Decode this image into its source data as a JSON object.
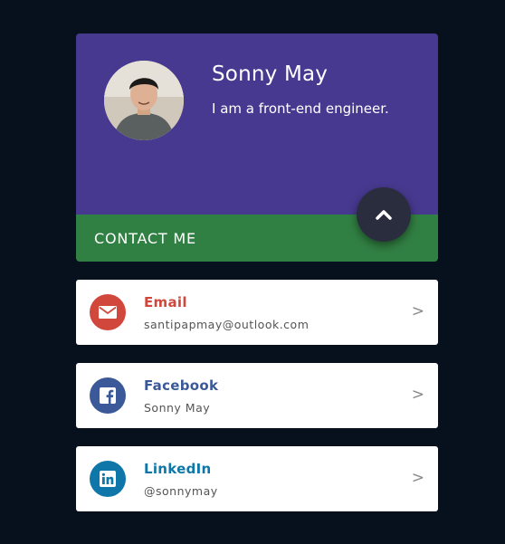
{
  "profile": {
    "name": "Sonny May",
    "tagline": "I am a front-end engineer.",
    "contact_label": "CONTACT ME",
    "colors": {
      "header": "#47398f",
      "contact_bar": "#318043",
      "fab": "#2a2d3d"
    }
  },
  "contacts": [
    {
      "title": "Email",
      "value": "santipapmay@outlook.com",
      "chevron": ">",
      "icon": "envelope-icon",
      "color": "#d2473b"
    },
    {
      "title": "Facebook",
      "value": "Sonny May",
      "chevron": ">",
      "icon": "facebook-icon",
      "color": "#3b5998"
    },
    {
      "title": "LinkedIn",
      "value": "@sonnymay",
      "chevron": ">",
      "icon": "linkedin-icon",
      "color": "#0e76a8"
    }
  ]
}
